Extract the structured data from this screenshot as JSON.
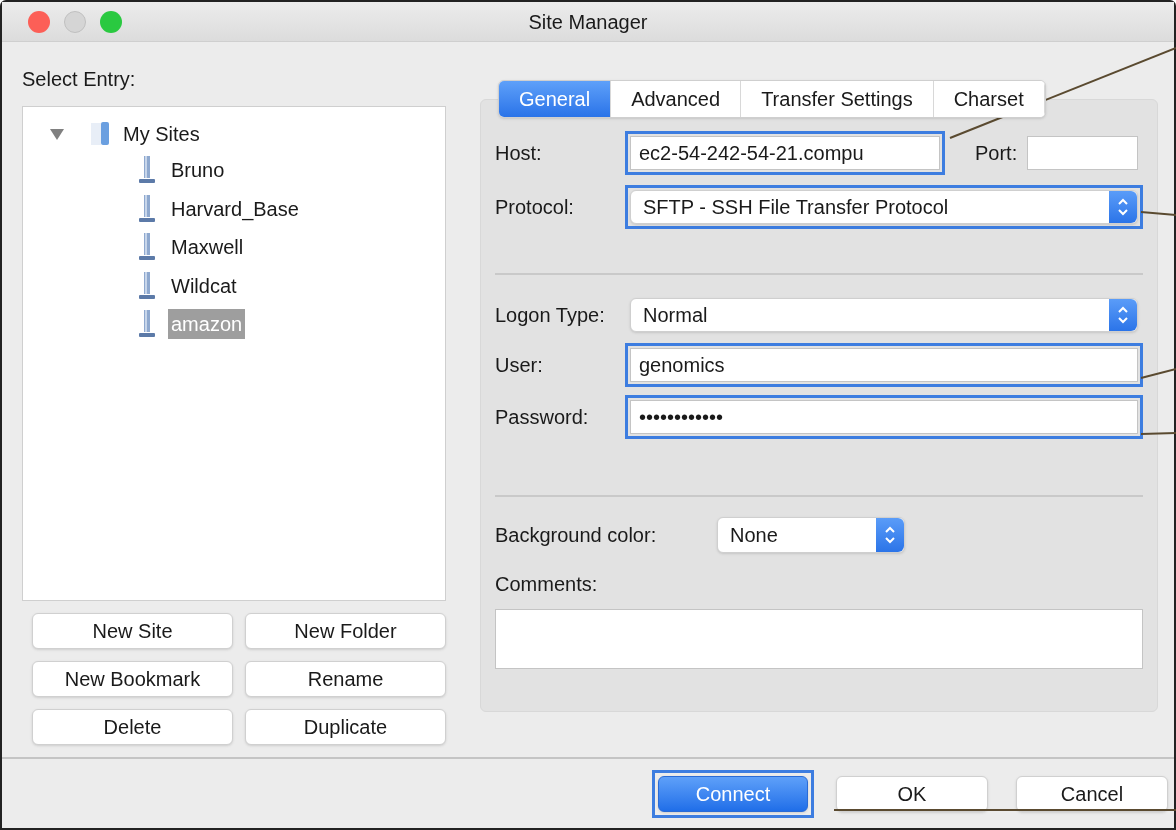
{
  "window": {
    "title": "Site Manager"
  },
  "select_entry_label": "Select Entry:",
  "tree": {
    "label": "My Sites",
    "expanded": true,
    "children": [
      {
        "label": "Bruno",
        "selected": false
      },
      {
        "label": "Harvard_Base",
        "selected": false
      },
      {
        "label": "Maxwell",
        "selected": false
      },
      {
        "label": "Wildcat",
        "selected": false
      },
      {
        "label": "amazon",
        "selected": true
      }
    ]
  },
  "entry_buttons": [
    "New Site",
    "New Folder",
    "New Bookmark",
    "Rename",
    "Delete",
    "Duplicate"
  ],
  "tabs": [
    {
      "label": "General",
      "selected": true
    },
    {
      "label": "Advanced",
      "selected": false
    },
    {
      "label": "Transfer Settings",
      "selected": false
    },
    {
      "label": "Charset",
      "selected": false
    }
  ],
  "general": {
    "host": {
      "label": "Host:",
      "value": "ec2-54-242-54-21.compu",
      "highlighted": true
    },
    "port": {
      "label": "Port:",
      "highlighted": false
    },
    "protocol": {
      "label": "Protocol:",
      "value": "SFTP - SSH File Transfer Protocol",
      "highlighted": true
    },
    "logon_type": {
      "label": "Logon Type:",
      "value": "Normal",
      "highlighted": false
    },
    "user": {
      "label": "User:",
      "value": "genomics",
      "highlighted": true
    },
    "password": {
      "label": "Password:",
      "value": "••••••••••••",
      "highlighted": true
    },
    "background_color": {
      "label": "Background color:",
      "value": "None"
    },
    "comments": {
      "label": "Comments:"
    }
  },
  "dialog_buttons": [
    {
      "label": "Connect",
      "default": true,
      "highlighted": true
    },
    {
      "label": "OK",
      "default": false,
      "highlighted": false
    },
    {
      "label": "Cancel",
      "default": false,
      "highlighted": false
    }
  ]
}
